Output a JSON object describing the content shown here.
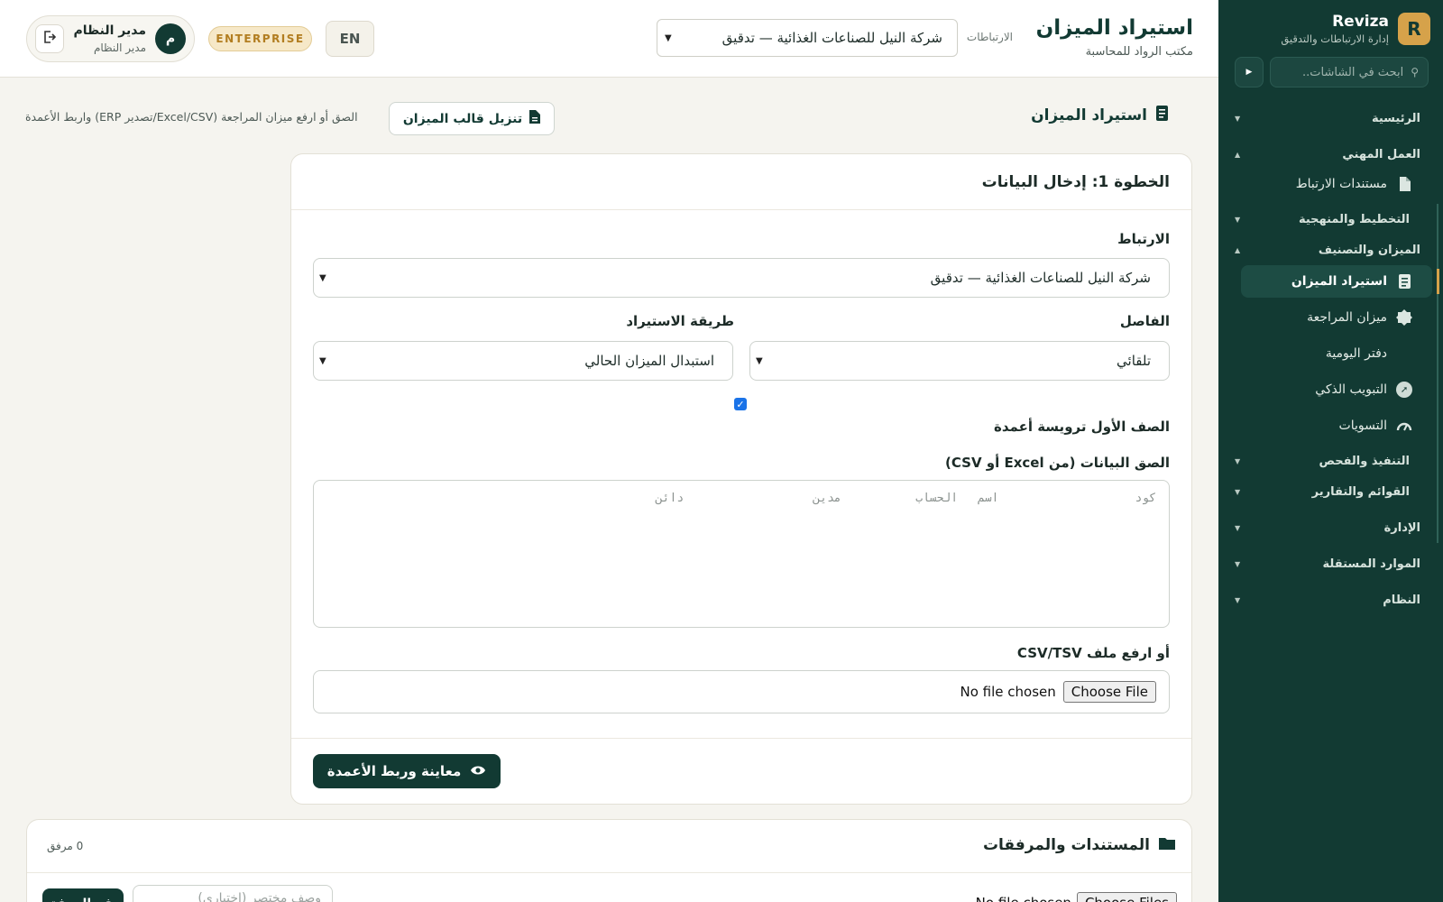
{
  "sidebar": {
    "brand_letter": "R",
    "brand_name": "Reviza",
    "brand_sub": "إدارة الارتباطات والتدقيق",
    "search_placeholder": "ابحث في الشاشات..",
    "sections": {
      "home": "الرئيسية",
      "professional": "العمل المهني",
      "planning": "التخطيط والمنهجية",
      "tb": "الميزان والتصنيف",
      "execution": "التنفيذ والفحص",
      "statements": "القوائم والتقارير",
      "admin": "الإدارة",
      "independent": "الموارد المستقلة",
      "system": "النظام"
    },
    "items": {
      "engagement_docs": "مستندات الارتباط",
      "tb_import": "استيراد الميزان",
      "trial_balance": "ميزان المراجعة",
      "journal": "دفتر اليومية",
      "smart_mapping": "التبويب الذكي",
      "adjustments": "التسويات"
    }
  },
  "topbar": {
    "title": "استيراد الميزان",
    "office": "مكتب الرواد للمحاسبة",
    "engagements_label": "الارتباطات",
    "engagement_value": "شركة النيل للصناعات الغذائية — تدقيق",
    "lang": "EN",
    "plan": "ENTERPRISE",
    "user_initial": "م",
    "user_name": "مدير النظام",
    "user_role": "مدير النظام"
  },
  "section": {
    "title": "استيراد الميزان",
    "template_button": "تنزيل قالب الميزان",
    "hint": "الصق أو ارفع ميزان المراجعة (Excel/CSV/تصدير ERP) واربط الأعمدة"
  },
  "step1": {
    "title": "الخطوة 1: إدخال البيانات",
    "engagement_label": "الارتباط",
    "engagement_value": "شركة النيل للصناعات الغذائية — تدقيق",
    "separator_label": "الفاصل",
    "separator_value": "تلقائي",
    "method_label": "طريقة الاستيراد",
    "method_value": "استبدال الميزان الحالي",
    "header_row_label": "الصف الأول ترويسة أعمدة",
    "header_row_checked": true,
    "paste_label": "الصق البيانات (من Excel أو CSV)",
    "paste_placeholder": "كود\tاسم الحساب\tمدين\tدائن",
    "upload_label": "أو ارفع ملف CSV/TSV",
    "choose_file": "Choose File",
    "no_file": "No file chosen",
    "preview_button": "معاينة وربط الأعمدة"
  },
  "attachments": {
    "title": "المستندات والمرفقات",
    "count": "0 مرفق",
    "choose_files": "Choose Files",
    "no_file": "No file chosen",
    "note_placeholder": "وصف مختصر (اختياري)",
    "upload_button": "رفع المرفق"
  },
  "colors": {
    "sidebar_bg": "#123a33",
    "accent_gold": "#d6a24a",
    "primary": "#123a33",
    "page_bg": "#f5f4ef"
  }
}
